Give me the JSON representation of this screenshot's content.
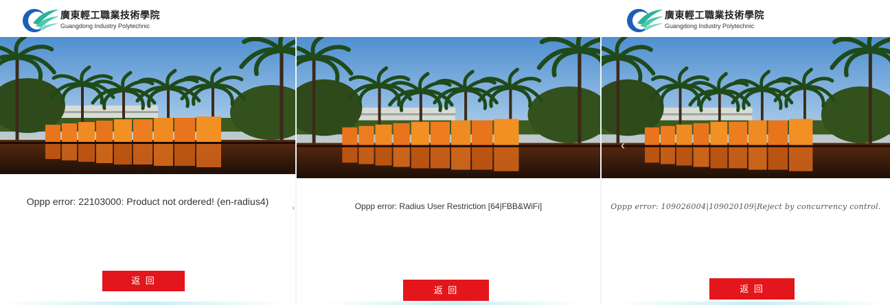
{
  "panels": [
    {
      "logo": {
        "cn": "廣東輕工職業技術學院",
        "en": "Guangdong Industry Polytechnic"
      },
      "error": "Oppp error: 22103000: Product not ordered! (en-radius4)",
      "button": "返 回"
    },
    {
      "logo": {
        "cn": "廣東輕工職業技術學院",
        "en": "Guangdong Industry Polytechnic"
      },
      "error": "Oppp error: Radius User Restriction [64|FBB&WiFi]",
      "button": "返 回"
    },
    {
      "logo": {
        "cn": "廣東輕工職業技術學院",
        "en": "Guangdong Industry Polytechnic"
      },
      "error": "Oppp error: 109026004|109020109|Reject by concurrency control.",
      "button": "返 回"
    }
  ],
  "icons": {
    "logo": "college-logo-icon",
    "carousel_prev": "chevron-left-icon"
  },
  "colors": {
    "button_bg": "#e3161b",
    "button_text": "#ffffff",
    "error_text": "#333333"
  }
}
